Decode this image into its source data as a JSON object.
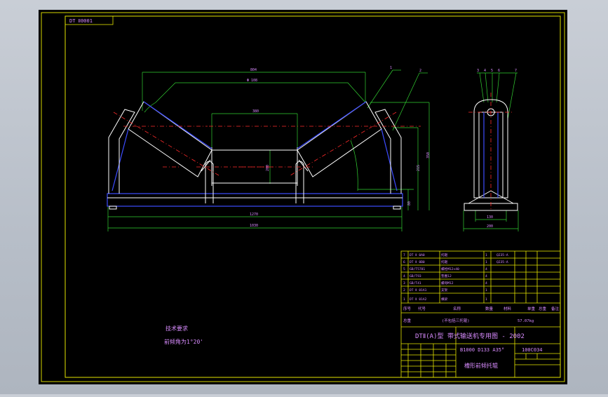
{
  "drawing": {
    "code_box": "DT Ⅱ0001",
    "dims": {
      "overall_top": "804",
      "inner_span": "Φ 108",
      "center_roll": "380",
      "mid_height": "200",
      "height_a": "80",
      "height_b": "215",
      "height_c": "350",
      "base_inner": "1270",
      "base_overall": "1030",
      "side_base_inner": "130",
      "side_base_overall": "200"
    },
    "balloons_front": [
      "1",
      "2"
    ],
    "balloons_side": [
      "3",
      "4",
      "5",
      "6",
      "7"
    ],
    "notes": {
      "title": "技术要求",
      "line1": "前倾角为1°20'"
    }
  },
  "title_block": {
    "parts": [
      [
        "7",
        "DT Ⅱ 0A0",
        "托辊",
        "1",
        "",
        "Q235-A",
        "",
        "",
        ""
      ],
      [
        "6",
        "DT Ⅱ 0B0",
        "托辊",
        "1",
        "",
        "Q235-A",
        "",
        "",
        ""
      ],
      [
        "5",
        "GB/T5781",
        "螺栓M12×40",
        "4",
        "",
        "",
        "",
        "",
        ""
      ],
      [
        "4",
        "GB/T93",
        "垫圈12",
        "4",
        "",
        "",
        "",
        "",
        ""
      ],
      [
        "3",
        "GB/T41",
        "螺母M12",
        "4",
        "",
        "",
        "",
        "",
        ""
      ],
      [
        "2",
        "DT Ⅱ 01A1",
        "支架",
        "1",
        "",
        "",
        "",
        "",
        ""
      ],
      [
        "1",
        "DT Ⅱ 01A2",
        "横梁",
        "1",
        "",
        "",
        "",
        "",
        ""
      ]
    ],
    "header": [
      "序号",
      "代号",
      "名称",
      "数量",
      "",
      "材料",
      "单重",
      "总重",
      "备注"
    ],
    "mass_row": [
      "总重",
      "(不包括三托辊)",
      "57.07kg"
    ],
    "project_title": "DTⅡ(A)型 带式输送机专用图 - 2002",
    "model": "B1000 D133 A35°",
    "drawing_no": "100C034",
    "part_name": "槽形前倾托辊"
  }
}
